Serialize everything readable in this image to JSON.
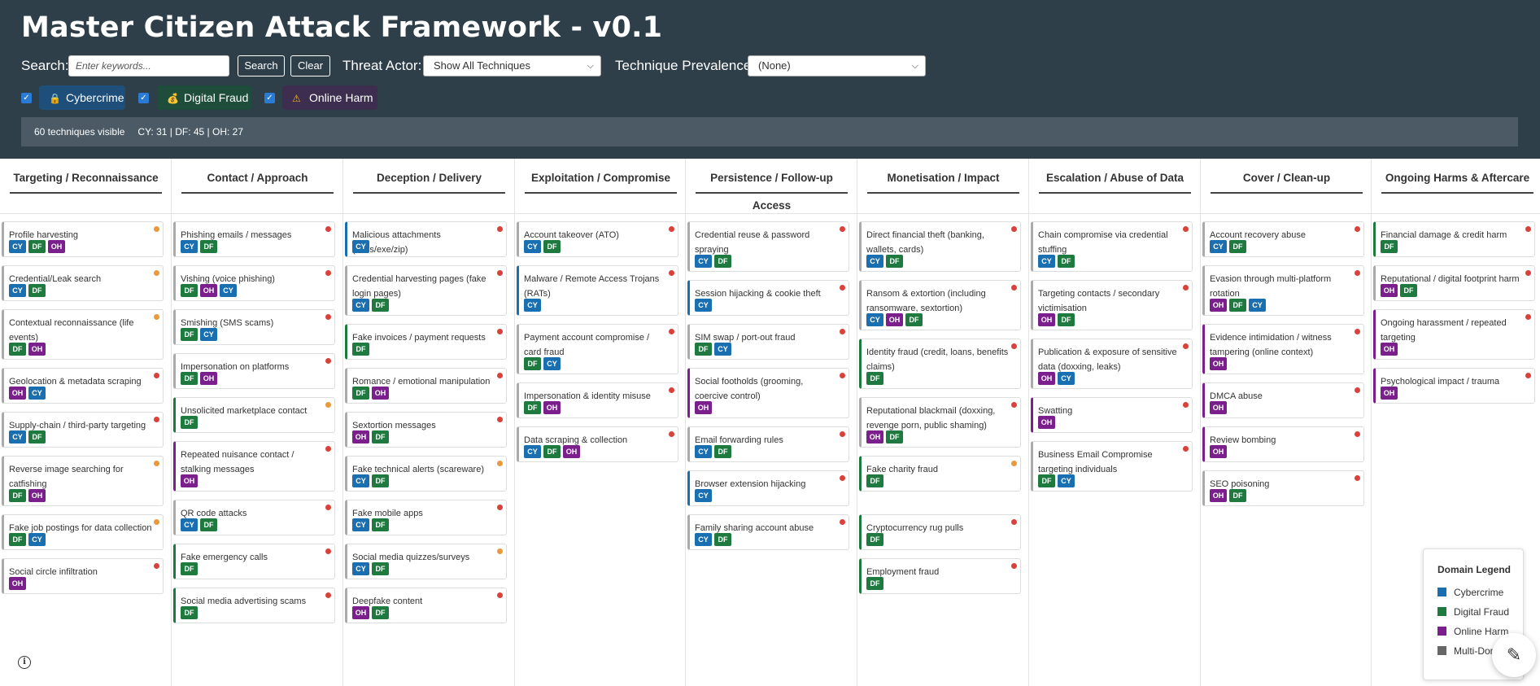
{
  "header": {
    "title": "Master Citizen Attack Framework - v0.1",
    "search_label": "Search:",
    "search_placeholder": "Enter keywords...",
    "search_button": "Search",
    "clear_button": "Clear",
    "threat_actor_label": "Threat Actor:",
    "threat_actor_value": "Show All Techniques",
    "prevalence_label": "Technique Prevalence:",
    "prevalence_value": "(None)"
  },
  "filters": [
    {
      "label": "Cybercrime",
      "icon": "lock-icon",
      "checked": true,
      "bg": "#1d4f7a"
    },
    {
      "label": "Digital Fraud",
      "icon": "moneybag-icon",
      "checked": true,
      "bg": "#1e4d3c"
    },
    {
      "label": "Online Harm",
      "icon": "warning-icon",
      "checked": true,
      "bg": "#3d2e50"
    }
  ],
  "status": {
    "visible": "60 techniques visible",
    "counts": "CY: 31 | DF: 45 | OH: 27"
  },
  "colors": {
    "CY": "#1a6fb0",
    "DF": "#1e7a3e",
    "OH": "#7a1f8c",
    "MULTI": "#666666",
    "red": "#d9413a",
    "orange": "#e89a3c"
  },
  "columns": [
    {
      "title": "Targeting / Reconnaissance",
      "cards": [
        {
          "name": "Profile harvesting",
          "tags": [
            "CY",
            "DF",
            "OH"
          ],
          "prev": "orange",
          "border": "#aaaaaa"
        },
        {
          "name": "Credential/Leak search",
          "tags": [
            "CY",
            "DF"
          ],
          "prev": "orange",
          "border": "#aaaaaa"
        },
        {
          "name": "Contextual reconnaissance (life events)",
          "tags": [
            "DF",
            "OH"
          ],
          "prev": "orange",
          "border": "#aaaaaa"
        },
        {
          "name": "Geolocation & metadata scraping",
          "tags": [
            "OH",
            "CY"
          ],
          "prev": "red",
          "border": "#aaaaaa"
        },
        {
          "name": "Supply-chain / third-party targeting",
          "tags": [
            "CY",
            "DF"
          ],
          "prev": "red",
          "border": "#aaaaaa"
        },
        {
          "name": "Reverse image searching for catfishing",
          "tags": [
            "DF",
            "OH"
          ],
          "prev": "orange",
          "border": "#aaaaaa"
        },
        {
          "name": "Fake job postings for data collection",
          "tags": [
            "DF",
            "CY"
          ],
          "prev": "orange",
          "border": "#aaaaaa"
        },
        {
          "name": "Social circle infiltration",
          "tags": [
            "OH"
          ],
          "prev": "red",
          "border": "#aaaaaa"
        }
      ]
    },
    {
      "title": "Contact / Approach",
      "cards": [
        {
          "name": "Phishing emails / messages",
          "tags": [
            "CY",
            "DF"
          ],
          "prev": "red",
          "border": "#aaaaaa"
        },
        {
          "name": "Vishing (voice phishing)",
          "tags": [
            "DF",
            "OH",
            "CY"
          ],
          "prev": "red",
          "border": "#aaaaaa"
        },
        {
          "name": "Smishing (SMS scams)",
          "tags": [
            "DF",
            "CY"
          ],
          "prev": "red",
          "border": "#aaaaaa"
        },
        {
          "name": "Impersonation on platforms",
          "tags": [
            "DF",
            "OH"
          ],
          "prev": "red",
          "border": "#aaaaaa"
        },
        {
          "name": "Unsolicited marketplace contact",
          "tags": [
            "DF"
          ],
          "prev": "orange",
          "border": "#1e7a3e"
        },
        {
          "name": "Repeated nuisance contact / stalking messages",
          "tags": [
            "OH"
          ],
          "prev": "red",
          "border": "#7a1f8c"
        },
        {
          "name": "QR code attacks",
          "tags": [
            "CY",
            "DF"
          ],
          "prev": "red",
          "border": "#aaaaaa"
        },
        {
          "name": "Fake emergency calls",
          "tags": [
            "DF"
          ],
          "prev": "red",
          "border": "#1e7a3e"
        },
        {
          "name": "Social media advertising scams",
          "tags": [
            "DF"
          ],
          "prev": "red",
          "border": "#1e7a3e"
        }
      ]
    },
    {
      "title": "Deception / Delivery",
      "cards": [
        {
          "name": "Malicious attachments (docs/exe/zip)",
          "tags": [
            "CY"
          ],
          "prev": "red",
          "border": "#1a6fb0"
        },
        {
          "name": "Credential harvesting pages (fake login pages)",
          "tags": [
            "CY",
            "DF"
          ],
          "prev": "red",
          "border": "#aaaaaa"
        },
        {
          "name": "Fake invoices / payment requests",
          "tags": [
            "DF"
          ],
          "prev": "red",
          "border": "#1e7a3e"
        },
        {
          "name": "Romance / emotional manipulation",
          "tags": [
            "DF",
            "OH"
          ],
          "prev": "red",
          "border": "#aaaaaa"
        },
        {
          "name": "Sextortion messages",
          "tags": [
            "OH",
            "DF"
          ],
          "prev": "red",
          "border": "#aaaaaa"
        },
        {
          "name": "Fake technical alerts (scareware)",
          "tags": [
            "CY",
            "DF"
          ],
          "prev": "orange",
          "border": "#aaaaaa"
        },
        {
          "name": "Fake mobile apps",
          "tags": [
            "CY",
            "DF"
          ],
          "prev": "red",
          "border": "#aaaaaa"
        },
        {
          "name": "Social media quizzes/surveys",
          "tags": [
            "CY",
            "DF"
          ],
          "prev": "orange",
          "border": "#aaaaaa"
        },
        {
          "name": "Deepfake content",
          "tags": [
            "OH",
            "DF"
          ],
          "prev": "red",
          "border": "#aaaaaa"
        }
      ]
    },
    {
      "title": "Exploitation / Compromise",
      "cards": [
        {
          "name": "Account takeover (ATO)",
          "tags": [
            "CY",
            "DF"
          ],
          "prev": "red",
          "border": "#aaaaaa"
        },
        {
          "name": "Malware / Remote Access Trojans (RATs)",
          "tags": [
            "CY"
          ],
          "prev": "red",
          "border": "#1a6fb0"
        },
        {
          "name": "Payment account compromise / card fraud",
          "tags": [
            "DF",
            "CY"
          ],
          "prev": "red",
          "border": "#aaaaaa"
        },
        {
          "name": "Impersonation & identity misuse",
          "tags": [
            "DF",
            "OH"
          ],
          "prev": "red",
          "border": "#aaaaaa"
        },
        {
          "name": "Data scraping & collection",
          "tags": [
            "CY",
            "DF",
            "OH"
          ],
          "prev": "red",
          "border": "#aaaaaa"
        }
      ]
    },
    {
      "title": "Persistence / Follow-up Access",
      "cards": [
        {
          "name": "Credential reuse & password spraying",
          "tags": [
            "CY",
            "DF"
          ],
          "prev": "red",
          "border": "#aaaaaa"
        },
        {
          "name": "Session hijacking & cookie theft",
          "tags": [
            "CY"
          ],
          "prev": "red",
          "border": "#1a6fb0"
        },
        {
          "name": "SIM swap / port-out fraud",
          "tags": [
            "DF",
            "CY"
          ],
          "prev": "red",
          "border": "#aaaaaa"
        },
        {
          "name": "Social footholds (grooming, coercive control)",
          "tags": [
            "OH"
          ],
          "prev": "red",
          "border": "#7a1f8c"
        },
        {
          "name": "Email forwarding rules",
          "tags": [
            "CY",
            "DF"
          ],
          "prev": "red",
          "border": "#aaaaaa"
        },
        {
          "name": "Browser extension hijacking",
          "tags": [
            "CY"
          ],
          "prev": "red",
          "border": "#1a6fb0"
        },
        {
          "name": "Family sharing account abuse",
          "tags": [
            "CY",
            "DF"
          ],
          "prev": "red",
          "border": "#aaaaaa"
        }
      ]
    },
    {
      "title": "Monetisation / Impact",
      "cards": [
        {
          "name": "Direct financial theft (banking, wallets, cards)",
          "tags": [
            "CY",
            "DF"
          ],
          "prev": "red",
          "border": "#aaaaaa"
        },
        {
          "name": "Ransom & extortion (including ransomware, sextortion)",
          "tags": [
            "CY",
            "OH",
            "DF"
          ],
          "prev": "red",
          "border": "#aaaaaa"
        },
        {
          "name": "Identity fraud (credit, loans, benefits claims)",
          "tags": [
            "DF"
          ],
          "prev": "red",
          "border": "#1e7a3e"
        },
        {
          "name": "Reputational blackmail (doxxing, revenge porn, public shaming)",
          "tags": [
            "OH",
            "DF"
          ],
          "prev": "red",
          "border": "#aaaaaa"
        },
        {
          "name": "Fake charity fraud",
          "tags": [
            "DF"
          ],
          "prev": "orange",
          "border": "#1e7a3e"
        },
        {
          "name": "Cryptocurrency rug pulls",
          "tags": [
            "DF"
          ],
          "prev": "red",
          "border": "#1e7a3e"
        },
        {
          "name": "Employment fraud",
          "tags": [
            "DF"
          ],
          "prev": "red",
          "border": "#1e7a3e"
        }
      ]
    },
    {
      "title": "Escalation / Abuse of Data",
      "cards": [
        {
          "name": "Chain compromise via credential stuffing",
          "tags": [
            "CY",
            "DF"
          ],
          "prev": "red",
          "border": "#aaaaaa"
        },
        {
          "name": "Targeting contacts / secondary victimisation",
          "tags": [
            "OH",
            "DF"
          ],
          "prev": "red",
          "border": "#aaaaaa"
        },
        {
          "name": "Publication & exposure of sensitive data (doxxing, leaks)",
          "tags": [
            "OH",
            "CY"
          ],
          "prev": "red",
          "border": "#aaaaaa"
        },
        {
          "name": "Swatting",
          "tags": [
            "OH"
          ],
          "prev": "red",
          "border": "#7a1f8c"
        },
        {
          "name": "Business Email Compromise targeting individuals",
          "tags": [
            "DF",
            "CY"
          ],
          "prev": "red",
          "border": "#aaaaaa"
        }
      ]
    },
    {
      "title": "Cover / Clean-up",
      "cards": [
        {
          "name": "Account recovery abuse",
          "tags": [
            "CY",
            "DF"
          ],
          "prev": "red",
          "border": "#aaaaaa"
        },
        {
          "name": "Evasion through multi-platform rotation",
          "tags": [
            "OH",
            "DF",
            "CY"
          ],
          "prev": "red",
          "border": "#aaaaaa"
        },
        {
          "name": "Evidence intimidation / witness tampering (online context)",
          "tags": [
            "OH"
          ],
          "prev": "red",
          "border": "#7a1f8c"
        },
        {
          "name": "DMCA abuse",
          "tags": [
            "OH"
          ],
          "prev": "red",
          "border": "#7a1f8c"
        },
        {
          "name": "Review bombing",
          "tags": [
            "OH"
          ],
          "prev": "red",
          "border": "#7a1f8c"
        },
        {
          "name": "SEO poisoning",
          "tags": [
            "OH",
            "DF"
          ],
          "prev": "red",
          "border": "#aaaaaa"
        }
      ]
    },
    {
      "title": "Ongoing Harms & Aftercare",
      "cards": [
        {
          "name": "Financial damage & credit harm",
          "tags": [
            "DF"
          ],
          "prev": "red",
          "border": "#1e7a3e"
        },
        {
          "name": "Reputational / digital footprint harm",
          "tags": [
            "OH",
            "DF"
          ],
          "prev": "red",
          "border": "#aaaaaa"
        },
        {
          "name": "Ongoing harassment / repeated targeting",
          "tags": [
            "OH"
          ],
          "prev": "red",
          "border": "#7a1f8c"
        },
        {
          "name": "Psychological impact / trauma",
          "tags": [
            "OH"
          ],
          "prev": "red",
          "border": "#7a1f8c"
        }
      ]
    }
  ],
  "legend": {
    "title": "Domain Legend",
    "items": [
      {
        "label": "Cybercrime",
        "color": "#1a6fb0"
      },
      {
        "label": "Digital Fraud",
        "color": "#1e7a3e"
      },
      {
        "label": "Online Harm",
        "color": "#7a1f8c"
      },
      {
        "label": "Multi-Domain",
        "color": "#666666"
      }
    ]
  },
  "fab_icon": "pencil-icon",
  "info_icon": "info-icon"
}
